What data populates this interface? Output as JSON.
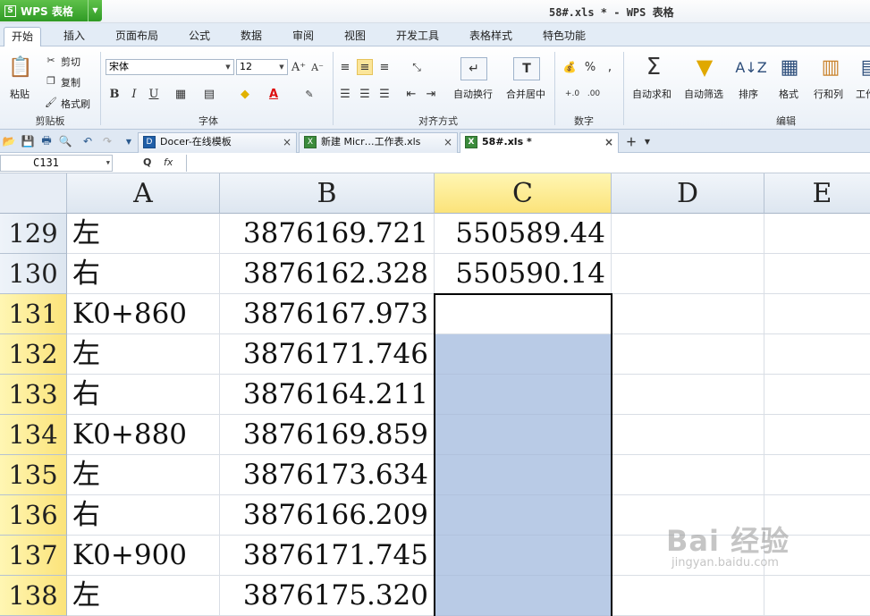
{
  "app": {
    "name": "WPS 表格",
    "logo": "S",
    "window_title": "58#.xls * - WPS 表格"
  },
  "tabs": [
    "开始",
    "插入",
    "页面布局",
    "公式",
    "数据",
    "审阅",
    "视图",
    "开发工具",
    "表格样式",
    "特色功能"
  ],
  "ribbon": {
    "clipboard": {
      "paste": "粘贴",
      "cut": "剪切",
      "copy": "复制",
      "format_painter": "格式刷",
      "label": "剪贴板"
    },
    "font": {
      "name": "宋体",
      "size": "12",
      "label": "字体",
      "bold": "B",
      "italic": "I",
      "underline": "U",
      "grow": "A⁺",
      "shrink": "A⁻"
    },
    "align": {
      "wrap": "自动换行",
      "merge": "合并居中",
      "label": "对齐方式"
    },
    "number": {
      "percent": "%",
      "label": "数字"
    },
    "edit": {
      "autosum": "自动求和",
      "autofilter": "自动筛选",
      "sort": "排序",
      "format": "格式",
      "rowcol": "行和列",
      "worksheet": "工作",
      "label": "编辑"
    }
  },
  "doc_tabs": [
    {
      "label": "Docer-在线模板",
      "icon": "D"
    },
    {
      "label": "新建 Micr…工作表.xls",
      "icon": "X"
    },
    {
      "label": "58#.xls *",
      "icon": "X"
    }
  ],
  "formula_bar": {
    "cell_ref": "C131",
    "fx": "fx",
    "zoom_glyph": "Q"
  },
  "columns": [
    "A",
    "B",
    "C",
    "D",
    "E"
  ],
  "rows": [
    {
      "num": "129",
      "a": "左",
      "b": "3876169.721",
      "c": "550589.44"
    },
    {
      "num": "130",
      "a": "右",
      "b": "3876162.328",
      "c": "550590.14"
    },
    {
      "num": "131",
      "a": "K0+860",
      "b": "3876167.973",
      "c": ""
    },
    {
      "num": "132",
      "a": "左",
      "b": "3876171.746",
      "c": ""
    },
    {
      "num": "133",
      "a": "右",
      "b": "3876164.211",
      "c": ""
    },
    {
      "num": "134",
      "a": "K0+880",
      "b": "3876169.859",
      "c": ""
    },
    {
      "num": "135",
      "a": "左",
      "b": "3876173.634",
      "c": ""
    },
    {
      "num": "136",
      "a": "右",
      "b": "3876166.209",
      "c": ""
    },
    {
      "num": "137",
      "a": "K0+900",
      "b": "3876171.745",
      "c": ""
    },
    {
      "num": "138",
      "a": "左",
      "b": "3876175.320",
      "c": ""
    }
  ],
  "watermark": {
    "text": "Bai 经验",
    "sub": "jingyan.baidu.com"
  },
  "colors": {
    "selection": "#b9cbe6",
    "header_selected": "#fbe37a",
    "app_green": "#2f9a25"
  }
}
